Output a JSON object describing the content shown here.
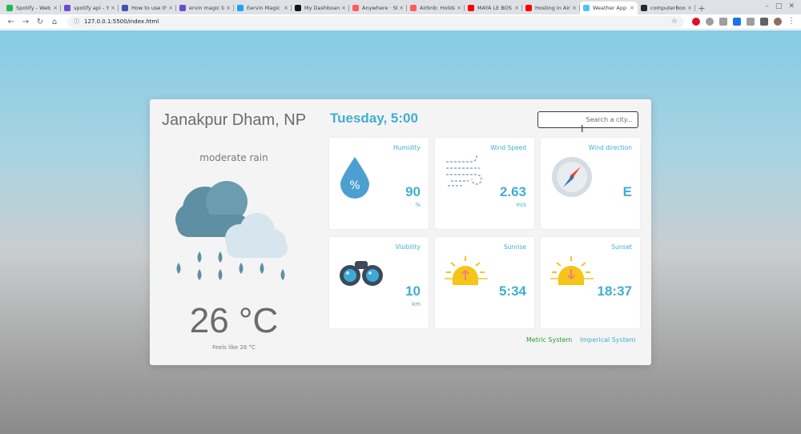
{
  "browser": {
    "tabs": [
      {
        "title": "Spotify - Web",
        "color": "#1db954"
      },
      {
        "title": "spotify api - Y",
        "color": "#6a4ad6"
      },
      {
        "title": "How to use th",
        "color": "#3f51b5"
      },
      {
        "title": "ervin magic ti",
        "color": "#6a4ad6"
      },
      {
        "title": "Eervin Magic",
        "color": "#1da1f2"
      },
      {
        "title": "My Dashboard",
        "color": "#191414"
      },
      {
        "title": "Anywhere · Sh",
        "color": "#ff5a5f"
      },
      {
        "title": "Airbnb: Holida",
        "color": "#ff5a5f"
      },
      {
        "title": "MAYA LE BOS",
        "color": "#ff0000"
      },
      {
        "title": "Hosting in Air",
        "color": "#ff0000"
      },
      {
        "title": "Weather App",
        "color": "#4fc3f7",
        "active": true
      },
      {
        "title": "computerBoo",
        "color": "#24292e"
      }
    ],
    "new_tab_glyph": "+",
    "url": "127.0.0.1:5500/index.html"
  },
  "weather": {
    "city": "Janakpur Dham, NP",
    "description": "moderate rain",
    "temperature": "26 °C",
    "feels_like": "Feels like 26 °C",
    "datetime": "Tuesday, 5:00",
    "search_placeholder": "Search a city..."
  },
  "tiles": {
    "humidity": {
      "label": "Humidity",
      "value": "90",
      "unit": "%",
      "icon": "humidity-drop-icon"
    },
    "wind_speed": {
      "label": "Wind Speed",
      "value": "2.63",
      "unit": "m/s",
      "icon": "wind-icon"
    },
    "wind_direction": {
      "label": "Wind direction",
      "value": "E",
      "icon": "compass-icon"
    },
    "visibility": {
      "label": "Visibility",
      "value": "10",
      "unit": "km",
      "icon": "binoculars-icon"
    },
    "sunrise": {
      "label": "Sunrise",
      "value": "5:34",
      "icon": "sunrise-icon"
    },
    "sunset": {
      "label": "Sunset",
      "value": "18:37",
      "icon": "sunset-icon"
    }
  },
  "units": {
    "metric": "Metric System",
    "imperial": "Imperical System"
  },
  "colors": {
    "accent": "#43aed0",
    "metric": "#2a9d2a",
    "text": "#6b6b6b"
  }
}
